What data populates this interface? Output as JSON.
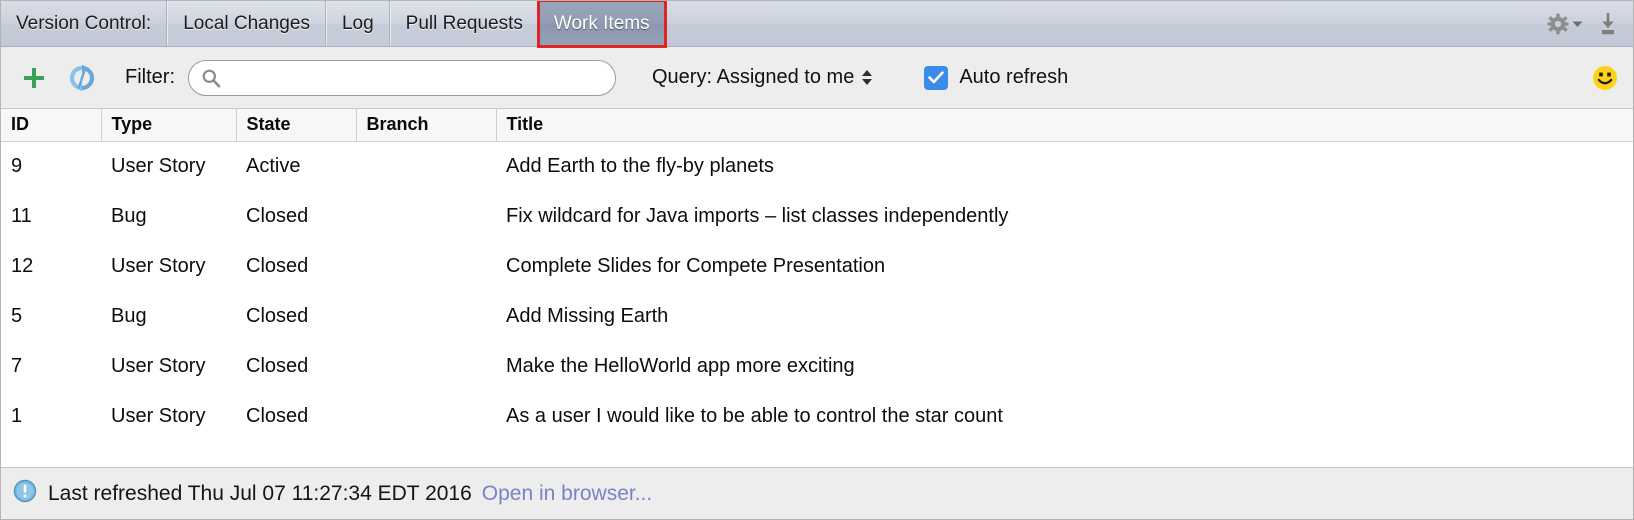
{
  "tabbar": {
    "title_label": "Version Control:",
    "tabs": [
      {
        "label": "Local Changes",
        "selected": false
      },
      {
        "label": "Log",
        "selected": false
      },
      {
        "label": "Pull Requests",
        "selected": false
      },
      {
        "label": "Work Items",
        "selected": true
      }
    ],
    "icons": {
      "settings": "gear-icon",
      "settings_dropdown": "chevron-down-icon",
      "hide": "hide-panel-icon"
    },
    "highlight_color": "#e02424",
    "selected_tab_bg": "#909db4"
  },
  "toolbar": {
    "add_label": "+",
    "add_icon": "plus-icon",
    "refresh_icon": "refresh-icon",
    "filter_label": "Filter:",
    "search": {
      "value": "",
      "placeholder": "",
      "icon": "search-icon"
    },
    "query": {
      "label": "Query: Assigned to me",
      "stepper_icon": "up-down-stepper-icon"
    },
    "auto_refresh": {
      "label": "Auto refresh",
      "checked": true,
      "check_color": "#3b8beb"
    },
    "status_icon": "smiley-face-icon"
  },
  "table": {
    "columns": [
      "ID",
      "Type",
      "State",
      "Branch",
      "Title"
    ],
    "rows": [
      {
        "id": "9",
        "type": "User Story",
        "state": "Active",
        "branch": "",
        "title": "Add Earth to the fly-by planets"
      },
      {
        "id": "11",
        "type": "Bug",
        "state": "Closed",
        "branch": "",
        "title": "Fix wildcard for Java imports – list classes independently"
      },
      {
        "id": "12",
        "type": "User Story",
        "state": "Closed",
        "branch": "",
        "title": "Complete Slides for Compete Presentation"
      },
      {
        "id": "5",
        "type": "Bug",
        "state": "Closed",
        "branch": "",
        "title": "Add Missing Earth"
      },
      {
        "id": "7",
        "type": "User Story",
        "state": "Closed",
        "branch": "",
        "title": "Make the HelloWorld app more exciting"
      },
      {
        "id": "1",
        "type": "User Story",
        "state": "Closed",
        "branch": "",
        "title": "As a user I would like to be able to control the star count"
      }
    ]
  },
  "statusbar": {
    "info_icon": "info-icon",
    "message": "Last refreshed Thu Jul 07 11:27:34 EDT 2016",
    "link": "Open in browser...",
    "link_color": "#7b82c8"
  }
}
